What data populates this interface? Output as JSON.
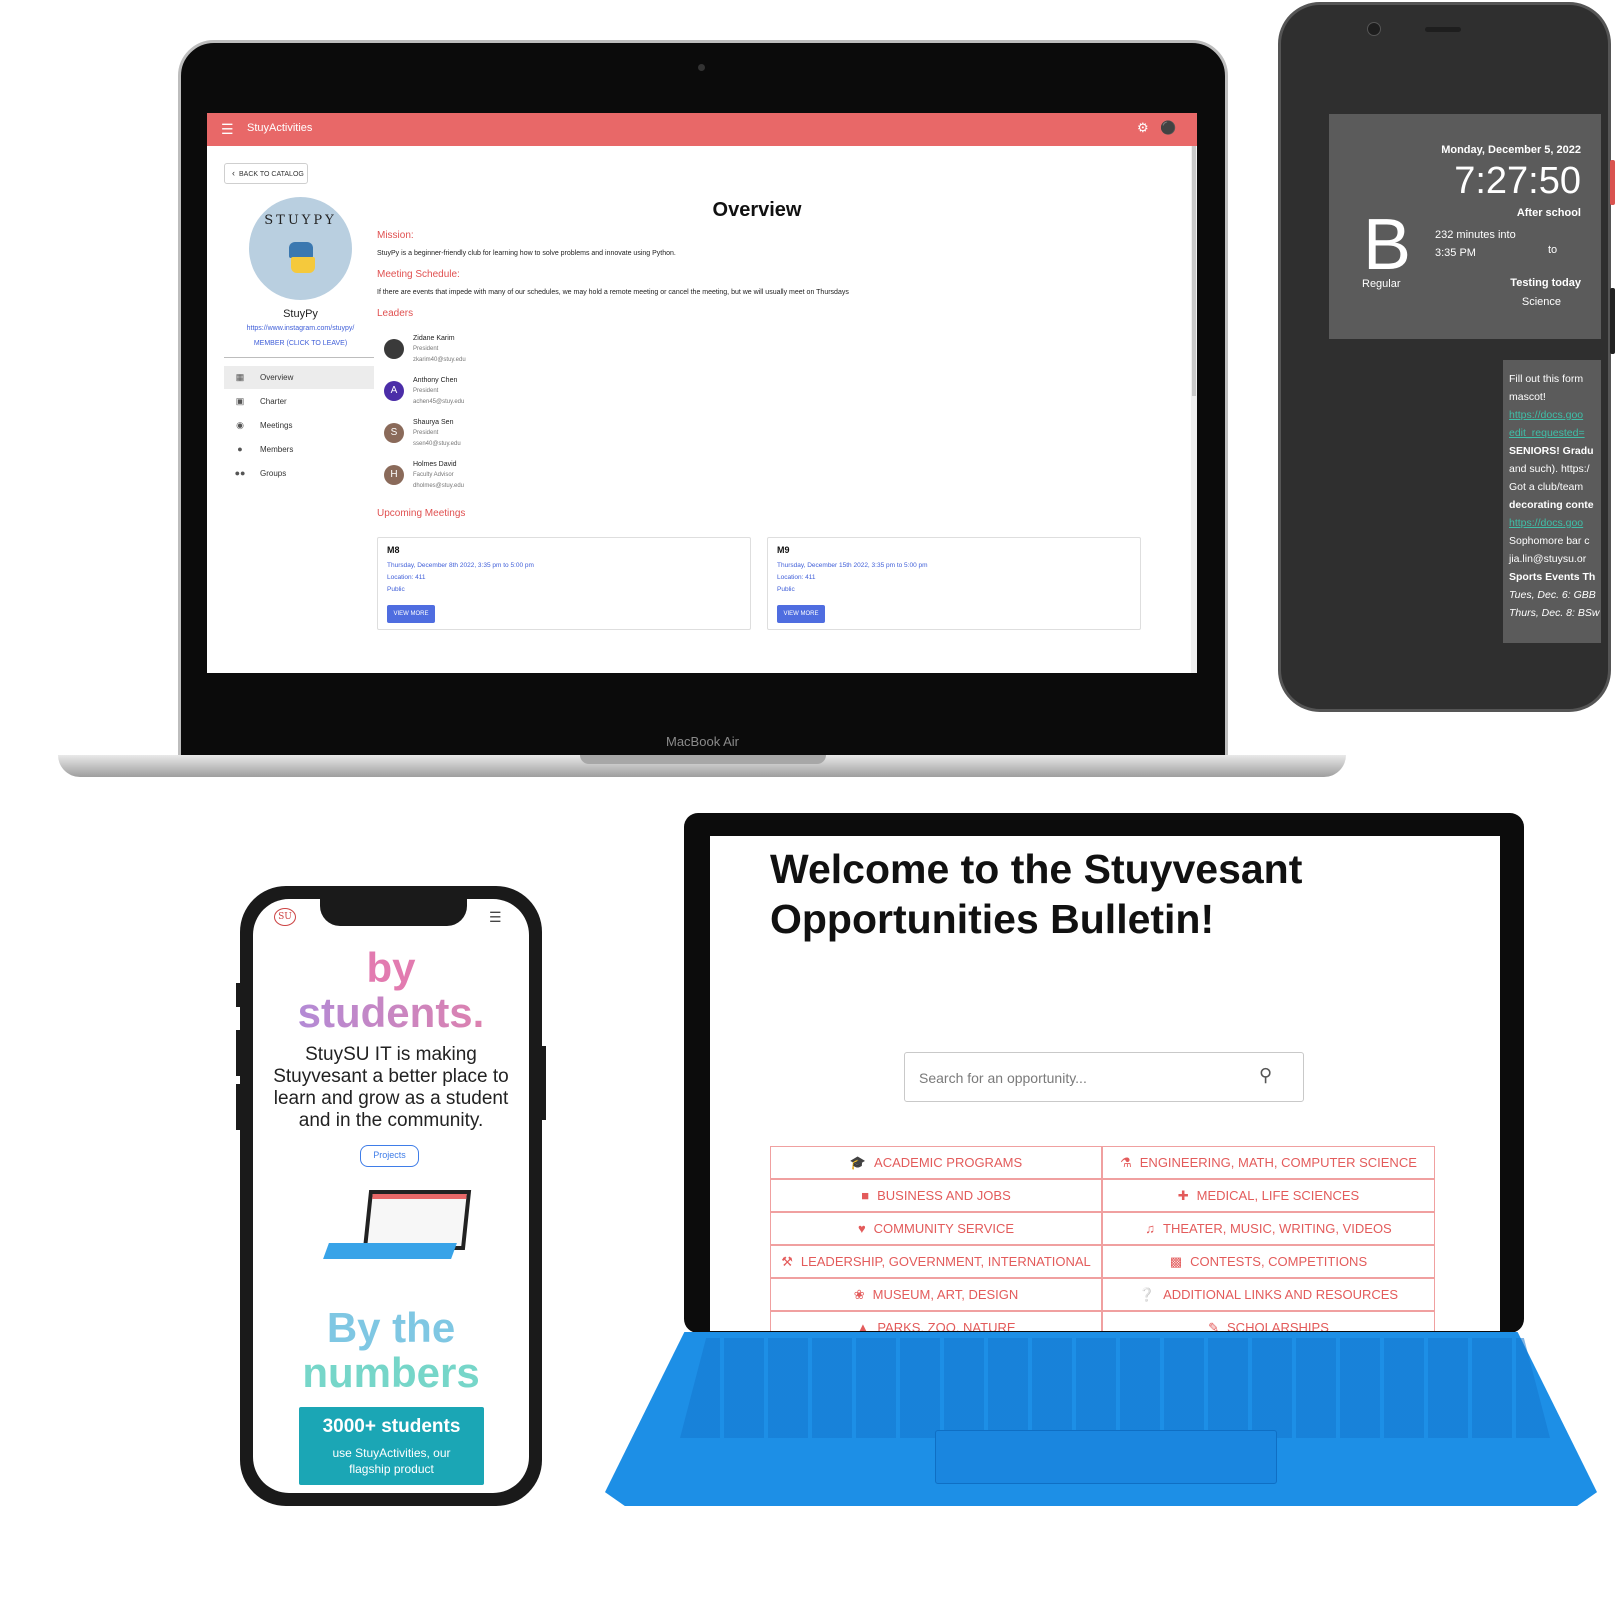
{
  "laptop": {
    "brand": "MacBook Air",
    "app_title": "StuyActivities",
    "back_label": "BACK TO CATALOG",
    "club": {
      "logo_text": "STUYPY",
      "name": "StuyPy",
      "link": "https://www.instagram.com/stuypy/",
      "member_label": "MEMBER (CLICK TO LEAVE)"
    },
    "nav": [
      {
        "label": "Overview",
        "icon": "dashboard-icon"
      },
      {
        "label": "Charter",
        "icon": "document-icon"
      },
      {
        "label": "Meetings",
        "icon": "globe-icon"
      },
      {
        "label": "Members",
        "icon": "person-icon"
      },
      {
        "label": "Groups",
        "icon": "people-icon"
      }
    ],
    "overview_title": "Overview",
    "mission_head": "Mission:",
    "mission_text": "StuyPy is a beginner-friendly club for learning how to solve problems and innovate using Python.",
    "schedule_head": "Meeting Schedule:",
    "schedule_text": "If there are events that impede with many of our schedules, we may hold a remote meeting or cancel the meeting, but we will usually meet on Thursdays",
    "leaders_head": "Leaders",
    "leaders": [
      {
        "initial": "",
        "name": "Zidane Karim",
        "role": "President",
        "email": "zkarim40@stuy.edu",
        "color": "#3a3a3a"
      },
      {
        "initial": "A",
        "name": "Anthony Chen",
        "role": "President",
        "email": "achen45@stuy.edu",
        "color": "#4b2da8"
      },
      {
        "initial": "S",
        "name": "Shaurya Sen",
        "role": "President",
        "email": "ssen40@stuy.edu",
        "color": "#8a6a5a"
      },
      {
        "initial": "H",
        "name": "Holmes David",
        "role": "Faculty Advisor",
        "email": "dholmes@stuy.edu",
        "color": "#8a6a5a"
      }
    ],
    "upcoming_head": "Upcoming Meetings",
    "meetings": [
      {
        "title": "M8",
        "date": "Thursday, December 8th 2022, 3:35 pm to 5:00 pm",
        "location": "Location: 411",
        "privacy": "Public",
        "button": "VIEW MORE"
      },
      {
        "title": "M9",
        "date": "Thursday, December 15th 2022, 3:35 pm to 5:00 pm",
        "location": "Location: 411",
        "privacy": "Public",
        "button": "VIEW MORE"
      }
    ]
  },
  "phone_right": {
    "date": "Monday, December 5, 2022",
    "time": "7:27:50",
    "status": "After school",
    "day_letter": "B",
    "schedule_type": "Regular",
    "minutes": "232 minutes into",
    "period_time": "3:35 PM",
    "to": "to",
    "testing_head": "Testing today",
    "testing_subject": "Science",
    "feed": [
      {
        "text": "Fill out this form",
        "style": "plain"
      },
      {
        "text": "mascot!",
        "style": "plain"
      },
      {
        "text": "https://docs.goo",
        "style": "link"
      },
      {
        "text": "edit_requested=",
        "style": "link"
      },
      {
        "text": "SENIORS! Gradu",
        "style": "bold"
      },
      {
        "text": "and such). https:/",
        "style": "plain"
      },
      {
        "text": "Got a club/team",
        "style": "plain"
      },
      {
        "text": "decorating conte",
        "style": "bold"
      },
      {
        "text": "https://docs.goo",
        "style": "link"
      },
      {
        "text": "Sophomore bar c",
        "style": "plain"
      },
      {
        "text": "jia.lin@stuysu.or",
        "style": "plain"
      },
      {
        "text": "Sports Events Th",
        "style": "bold"
      },
      {
        "text": "Tues, Dec. 6: GBB",
        "style": "italic"
      },
      {
        "text": "Thurs, Dec. 8: BSw",
        "style": "italic"
      }
    ]
  },
  "phone_left": {
    "logo": "SU",
    "headline_by": "by",
    "headline_students": "students.",
    "body": "StuySU IT is making Stuyvesant a better place to learn and grow as a student and in the community.",
    "projects_button": "Projects",
    "numbers_line1": "By the",
    "numbers_line2": "numbers",
    "stat_big": "3000+ students",
    "stat_small": "use StuyActivities, our flagship product"
  },
  "tablet": {
    "title": "Welcome to the Stuyvesant Opportunities Bulletin!",
    "search_placeholder": "Search for an opportunity...",
    "categories": [
      {
        "label": "ACADEMIC PROGRAMS",
        "icon": "graduation-cap-icon"
      },
      {
        "label": "ENGINEERING, MATH, COMPUTER SCIENCE",
        "icon": "flask-icon"
      },
      {
        "label": "BUSINESS AND JOBS",
        "icon": "briefcase-icon"
      },
      {
        "label": "MEDICAL, LIFE SCIENCES",
        "icon": "medical-icon"
      },
      {
        "label": "COMMUNITY SERVICE",
        "icon": "helping-hand-icon"
      },
      {
        "label": "THEATER, MUSIC, WRITING, VIDEOS",
        "icon": "theater-icon"
      },
      {
        "label": "LEADERSHIP, GOVERNMENT, INTERNATIONAL",
        "icon": "gavel-icon"
      },
      {
        "label": "CONTESTS, COMPETITIONS",
        "icon": "ticket-icon"
      },
      {
        "label": "MUSEUM, ART, DESIGN",
        "icon": "palette-icon"
      },
      {
        "label": "ADDITIONAL LINKS AND RESOURCES",
        "icon": "question-icon"
      },
      {
        "label": "PARKS, ZOO, NATURE",
        "icon": "tree-icon"
      },
      {
        "label": "SCHOLARSHIPS",
        "icon": "scholarship-icon"
      }
    ]
  }
}
